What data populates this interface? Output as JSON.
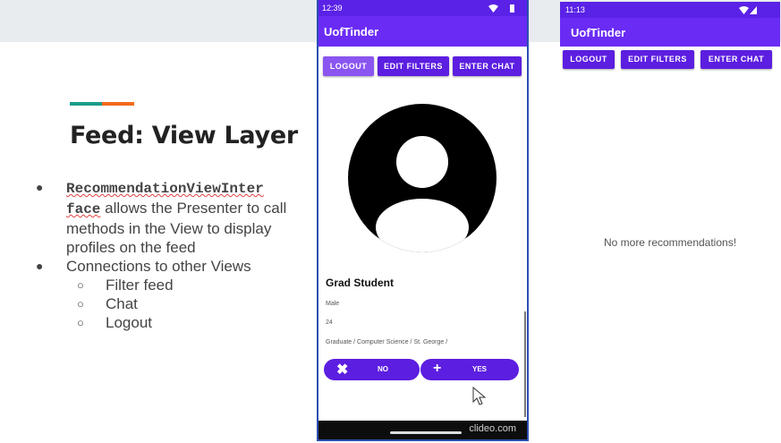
{
  "slide": {
    "title": "Feed: View Layer",
    "bullets": {
      "b1_code": "RecommendationViewInter face",
      "b1_text": " allows the Presenter to call methods in the View to display profiles on the feed",
      "b2_text": "Connections to other Views",
      "sub": [
        "Filter feed",
        "Chat",
        "Logout"
      ]
    }
  },
  "phone1": {
    "status_time": "12:39",
    "app_title": "UofTinder",
    "buttons": {
      "logout": "LOGOUT",
      "edit_filters": "EDIT FILTERS",
      "enter_chat": "ENTER CHAT"
    },
    "profile": {
      "name": "Grad Student",
      "gender": "Male",
      "age": "24",
      "details": "Graduate / Computer Science / St. George /"
    },
    "actions": {
      "no": "NO",
      "yes": "YES"
    },
    "watermark": "clideo.com"
  },
  "phone2": {
    "status_time": "11:13",
    "app_title": "UofTinder",
    "buttons": {
      "logout": "LOGOUT",
      "edit_filters": "EDIT FILTERS",
      "enter_chat": "ENTER CHAT"
    },
    "empty_message": "No more recommendations!"
  },
  "colors": {
    "app_purple": "#6a2bf5",
    "button_purple": "#5c1ee0",
    "accent_teal": "#1a9e8a",
    "accent_orange": "#f26a1b"
  },
  "icons": [
    "close-icon",
    "plus-icon",
    "cursor-icon",
    "avatar-icon",
    "wifi-icon",
    "battery-icon"
  ]
}
